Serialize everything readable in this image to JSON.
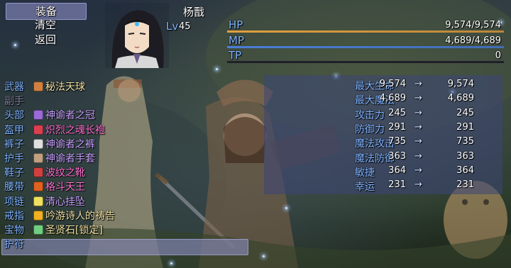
{
  "command_menu": {
    "items": [
      {
        "label": "装备",
        "selected": true
      },
      {
        "label": "清空",
        "selected": false
      },
      {
        "label": "返回",
        "selected": false
      }
    ]
  },
  "actor": {
    "name": "杨戬",
    "level_label": "Lv",
    "level": "45",
    "hp": {
      "label": "HP",
      "value": "9,574/9,574",
      "fraction": 1.0,
      "color": "#e0a040"
    },
    "mp": {
      "label": "MP",
      "value": "4,689/4,689",
      "fraction": 1.0,
      "color": "#4a7fd8"
    },
    "tp": {
      "label": "TP",
      "value": "0",
      "fraction": 0.0,
      "color": "#40c080"
    }
  },
  "equipment": [
    {
      "slot": "武器",
      "item": "秘法天球",
      "icon": "wand-icon",
      "item_color": "#f0e0a0",
      "dim": false
    },
    {
      "slot": "副手",
      "item": "",
      "icon": "",
      "item_color": "#ffffff",
      "dim": true
    },
    {
      "slot": "头部",
      "item": "神谕者之冠",
      "icon": "crown-icon",
      "item_color": "#c8a0ff",
      "dim": false
    },
    {
      "slot": "盔甲",
      "item": "炽烈之魂长袍",
      "icon": "robe-icon",
      "item_color": "#ff70d0",
      "dim": false
    },
    {
      "slot": "裤子",
      "item": "神谕者之裤",
      "icon": "pants-icon",
      "item_color": "#c8a0ff",
      "dim": false
    },
    {
      "slot": "护手",
      "item": "神谕者手套",
      "icon": "glove-icon",
      "item_color": "#c8a0ff",
      "dim": false
    },
    {
      "slot": "鞋子",
      "item": "波纹之靴",
      "icon": "boots-icon",
      "item_color": "#ff70d0",
      "dim": false
    },
    {
      "slot": "腰带",
      "item": "格斗天王",
      "icon": "belt-icon",
      "item_color": "#ff70d0",
      "dim": false
    },
    {
      "slot": "项链",
      "item": "清心挂坠",
      "icon": "necklace-icon",
      "item_color": "#c8a0ff",
      "dim": false
    },
    {
      "slot": "戒指",
      "item": "吟游诗人的祷告",
      "icon": "ring-icon",
      "item_color": "#f0e0a0",
      "dim": false
    },
    {
      "slot": "宝物",
      "item": "圣贤石[锁定]",
      "icon": "gem-icon",
      "item_color": "#f0e0a0",
      "dim": false
    },
    {
      "slot": "护符",
      "item": "",
      "icon": "",
      "item_color": "#ffffff",
      "dim": false,
      "selected": true
    }
  ],
  "stats": [
    {
      "label": "最大生命",
      "old": "9,574",
      "arrow": "→",
      "new": "9,574"
    },
    {
      "label": "最大魔法",
      "old": "4,689",
      "arrow": "→",
      "new": "4,689"
    },
    {
      "label": "攻击力",
      "old": "245",
      "arrow": "→",
      "new": "245"
    },
    {
      "label": "防御力",
      "old": "291",
      "arrow": "→",
      "new": "291"
    },
    {
      "label": "魔法攻击",
      "old": "735",
      "arrow": "→",
      "new": "735"
    },
    {
      "label": "魔法防御",
      "old": "363",
      "arrow": "→",
      "new": "363"
    },
    {
      "label": "敏捷",
      "old": "364",
      "arrow": "→",
      "new": "364"
    },
    {
      "label": "幸运",
      "old": "231",
      "arrow": "→",
      "new": "231"
    }
  ]
}
